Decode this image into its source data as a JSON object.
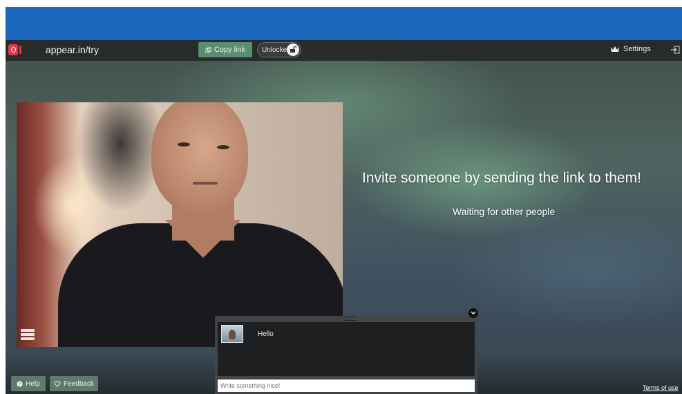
{
  "app": {
    "room_name": "appear.in/try",
    "copy_link_label": "Copy link",
    "lock_status_label": "Unlocked",
    "settings_label": "Settings"
  },
  "main": {
    "invite_heading": "Invite someone by sending the link to them!",
    "waiting_text": "Waiting for other people"
  },
  "chat": {
    "messages": [
      {
        "text": "Hello"
      }
    ],
    "input_placeholder": "Write something nice!"
  },
  "footer": {
    "help_label": "Help",
    "feedback_label": "Feedback",
    "terms_label": "Terms of use"
  },
  "icons": {
    "logo": "appear-in-logo",
    "copy": "copy-link-icon",
    "lock": "unlock-icon",
    "settings": "crown-icon",
    "exit": "exit-icon",
    "layout": "layout-icon",
    "chat_close": "chevron-down-icon",
    "help": "question-icon",
    "feedback": "heart-icon"
  },
  "colors": {
    "top_band": "#1c67be",
    "logo": "#e23a4a",
    "copy_button": "#5b8d70",
    "footer_buttons": "#5d7a6b"
  }
}
